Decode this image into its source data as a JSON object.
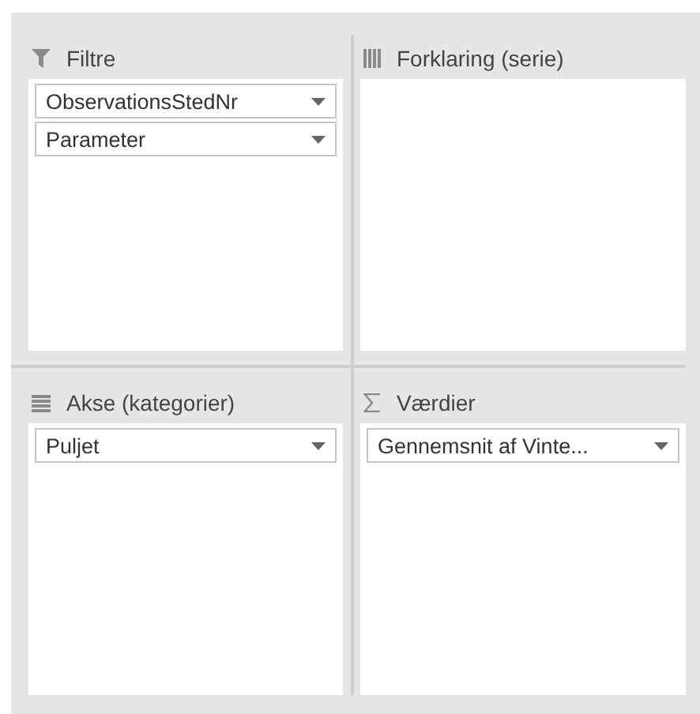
{
  "areas": [
    {
      "kind": "filters",
      "title": "Filtre",
      "fields": [
        {
          "label": "ObservationsStedNr"
        },
        {
          "label": "Parameter"
        }
      ]
    },
    {
      "kind": "columns",
      "title": "Forklaring (serie)"
    },
    {
      "kind": "rows",
      "title": "Akse (kategorier)",
      "fields": [
        {
          "label": "Puljet"
        }
      ]
    },
    {
      "kind": "values",
      "title": "Værdier",
      "fields": [
        {
          "label": "Gennemsnit af Vinte..."
        }
      ]
    }
  ]
}
